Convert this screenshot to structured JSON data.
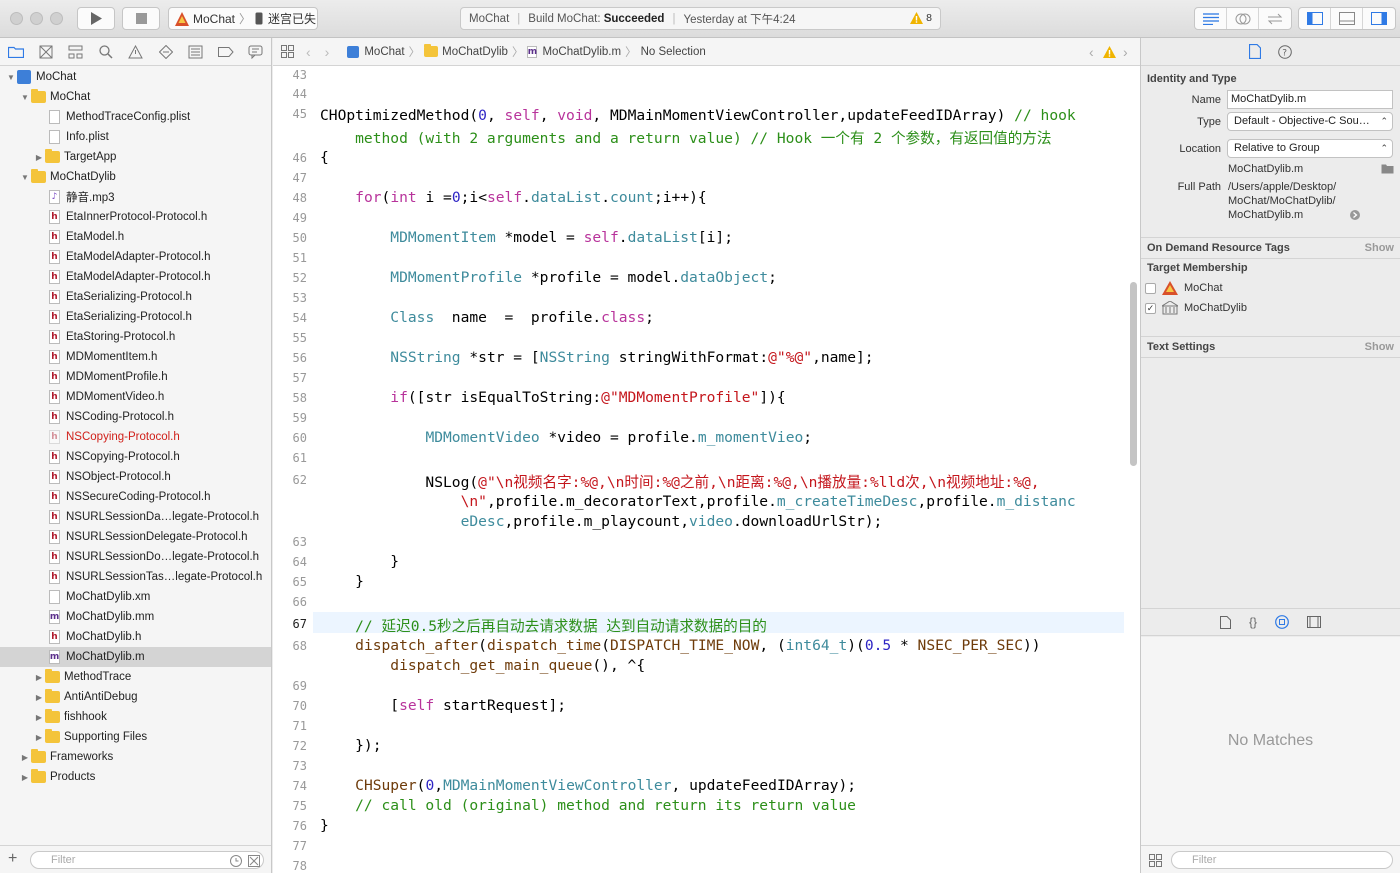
{
  "toolbar": {
    "scheme_target": "MoChat",
    "scheme_device": "迷宫已失",
    "activity_project": "MoChat",
    "activity_build": "Build MoChat:",
    "activity_status": "Succeeded",
    "activity_time": "Yesterday at 下午4:24",
    "warning_count": "8"
  },
  "jumpbar": {
    "crumbs": [
      "MoChat",
      "MoChatDylib",
      "MoChatDylib.m",
      "No Selection"
    ]
  },
  "navigator": {
    "filter_placeholder": "Filter",
    "items": [
      {
        "label": "MoChat"
      },
      {
        "label": "MoChat"
      },
      {
        "label": "MethodTraceConfig.plist"
      },
      {
        "label": "Info.plist"
      },
      {
        "label": "TargetApp"
      },
      {
        "label": "MoChatDylib"
      },
      {
        "label": "静音.mp3"
      },
      {
        "label": "EtaInnerProtocol-Protocol.h"
      },
      {
        "label": "EtaModel.h"
      },
      {
        "label": "EtaModelAdapter-Protocol.h"
      },
      {
        "label": "EtaModelAdapter-Protocol.h"
      },
      {
        "label": "EtaSerializing-Protocol.h"
      },
      {
        "label": "EtaSerializing-Protocol.h"
      },
      {
        "label": "EtaStoring-Protocol.h"
      },
      {
        "label": "MDMomentItem.h"
      },
      {
        "label": "MDMomentProfile.h"
      },
      {
        "label": "MDMomentVideo.h"
      },
      {
        "label": "NSCoding-Protocol.h"
      },
      {
        "label": "NSCopying-Protocol.h"
      },
      {
        "label": "NSCopying-Protocol.h"
      },
      {
        "label": "NSObject-Protocol.h"
      },
      {
        "label": "NSSecureCoding-Protocol.h"
      },
      {
        "label": "NSURLSessionDa…legate-Protocol.h"
      },
      {
        "label": "NSURLSessionDelegate-Protocol.h"
      },
      {
        "label": "NSURLSessionDo…legate-Protocol.h"
      },
      {
        "label": "NSURLSessionTas…legate-Protocol.h"
      },
      {
        "label": "MoChatDylib.xm"
      },
      {
        "label": "MoChatDylib.mm"
      },
      {
        "label": "MoChatDylib.h"
      },
      {
        "label": "MoChatDylib.m"
      },
      {
        "label": "MethodTrace"
      },
      {
        "label": "AntiAntiDebug"
      },
      {
        "label": "fishhook"
      },
      {
        "label": "Supporting Files"
      },
      {
        "label": "Frameworks"
      },
      {
        "label": "Products"
      }
    ]
  },
  "editor": {
    "line_numbers": [
      "43",
      "44",
      "45",
      "46",
      "47",
      "48",
      "49",
      "50",
      "51",
      "52",
      "53",
      "54",
      "55",
      "56",
      "57",
      "58",
      "59",
      "60",
      "61",
      "62",
      "63",
      "64",
      "65",
      "66",
      "67",
      "68",
      "69",
      "70",
      "71",
      "72",
      "73",
      "74",
      "75",
      "76",
      "77",
      "78"
    ],
    "current_line": "67"
  },
  "inspector": {
    "identity_title": "Identity and Type",
    "name_label": "Name",
    "name_value": "MoChatDylib.m",
    "type_label": "Type",
    "type_value": "Default - Objective-C Sou…",
    "location_label": "Location",
    "location_value": "Relative to Group",
    "location_file": "MoChatDylib.m",
    "fullpath_label": "Full Path",
    "fullpath_1": "/Users/apple/Desktop/",
    "fullpath_2": "MoChat/MoChatDylib/",
    "fullpath_3": "MoChatDylib.m",
    "odr_title": "On Demand Resource Tags",
    "show": "Show",
    "membership_title": "Target Membership",
    "target_1": "MoChat",
    "target_2": "MoChatDylib",
    "text_settings_title": "Text Settings",
    "no_matches": "No Matches",
    "filter_placeholder": "Filter"
  }
}
